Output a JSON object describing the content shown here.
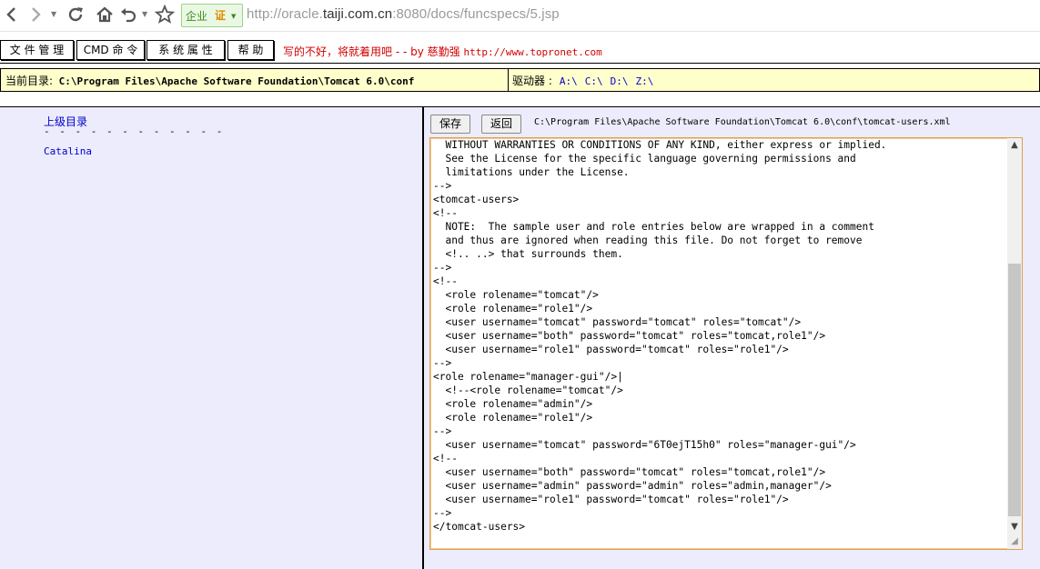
{
  "browser": {
    "url_prefix": "http://oracle.",
    "url_domain": "taiji.com.cn",
    "url_suffix": ":8080/docs/funcspecs/5.jsp",
    "badge_text": "企业",
    "badge_cert": "证"
  },
  "menu": {
    "file_manage": "文 件 管 理",
    "cmd": "CMD 命 令",
    "sys_props": "系 统 属 性",
    "help": "帮 助",
    "slogan": "写的不好，将就着用吧 - - by 慈勤强",
    "slogan_url": "http://www.topronet.com"
  },
  "path_bar": {
    "current_label": "当前目录:",
    "current_path": "C:\\Program Files\\Apache Software Foundation\\Tomcat 6.0\\conf",
    "drives_label": "驱动器 :",
    "drives": [
      "A:\\",
      "C:\\",
      "D:\\",
      "Z:\\"
    ]
  },
  "left_panel": {
    "parent_dir": "上级目录",
    "dashes": "- - - - - - - - - - - -",
    "items": [
      "Catalina"
    ]
  },
  "editor": {
    "save_label": "保存",
    "back_label": "返回",
    "file_path": "C:\\Program Files\\Apache Software Foundation\\Tomcat 6.0\\conf\\tomcat-users.xml",
    "lines": [
      "  WITHOUT WARRANTIES OR CONDITIONS OF ANY KIND, either express or implied.",
      "  See the License for the specific language governing permissions and",
      "  limitations under the License.",
      "-->",
      "<tomcat-users>",
      "<!--",
      "  NOTE:  The sample user and role entries below are wrapped in a comment",
      "  and thus are ignored when reading this file. Do not forget to remove",
      "  <!.. ..> that surrounds them.",
      "-->",
      "<!--",
      "  <role rolename=\"tomcat\"/>",
      "  <role rolename=\"role1\"/>",
      "  <user username=\"tomcat\" password=\"tomcat\" roles=\"tomcat\"/>",
      "  <user username=\"both\" password=\"tomcat\" roles=\"tomcat,role1\"/>",
      "  <user username=\"role1\" password=\"tomcat\" roles=\"role1\"/>",
      "-->",
      "<role rolename=\"manager-gui\"/>|",
      "  <!--<role rolename=\"tomcat\"/>",
      "  <role rolename=\"admin\"/>",
      "  <role rolename=\"role1\"/>",
      "-->",
      "  <user username=\"tomcat\" password=\"6T0ejT15h0\" roles=\"manager-gui\"/>",
      "<!--",
      "  <user username=\"both\" password=\"tomcat\" roles=\"tomcat,role1\"/>",
      "  <user username=\"admin\" password=\"admin\" roles=\"admin,manager\"/>",
      "  <user username=\"role1\" password=\"tomcat\" roles=\"role1\"/>",
      "-->",
      "</tomcat-users>"
    ]
  }
}
